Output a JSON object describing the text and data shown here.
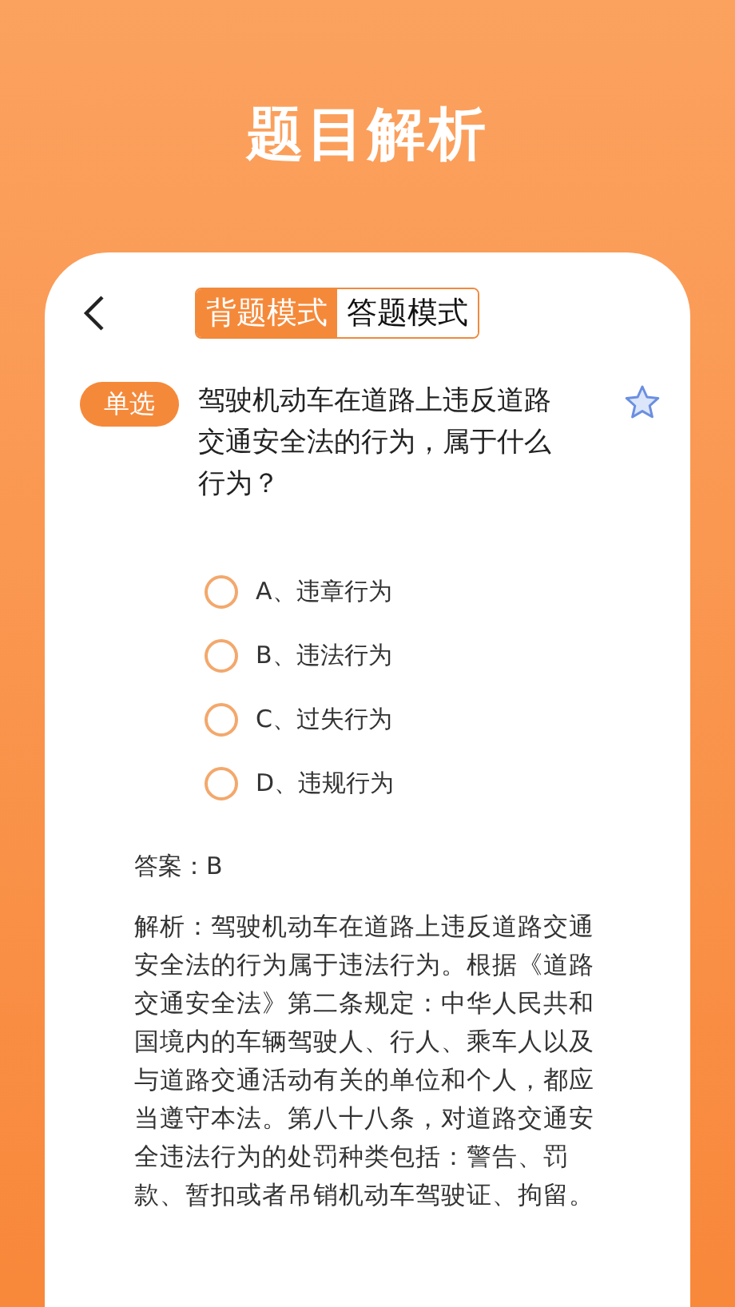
{
  "header": {
    "title": "题目解析"
  },
  "modes": [
    {
      "label": "背题模式",
      "selected": true
    },
    {
      "label": "答题模式",
      "selected": false
    }
  ],
  "question": {
    "tag": "单选",
    "text": "驾驶机动车在道路上违反道路交通安全法的行为，属于什么行为？"
  },
  "options": [
    {
      "label": "A、违章行为",
      "selected": false
    },
    {
      "label": "B、违法行为",
      "selected": false
    },
    {
      "label": "C、过失行为",
      "selected": false
    },
    {
      "label": "D、违规行为",
      "selected": false
    }
  ],
  "answer": "答案：B",
  "explanation": "解析：驾驶机动车在道路上违反道路交通安全法的行为属于违法行为。根据《道路交通安全法》第二条规定：中华人民共和国境内的车辆驾驶人、行人、乘车人以及与道路交通活动有关的单位和个人，都应当遵守本法。第八十八条，对道路交通安全违法行为的处罚种类包括：警告、罚款、暂扣或者吊销机动车驾驶证、拘留。"
}
